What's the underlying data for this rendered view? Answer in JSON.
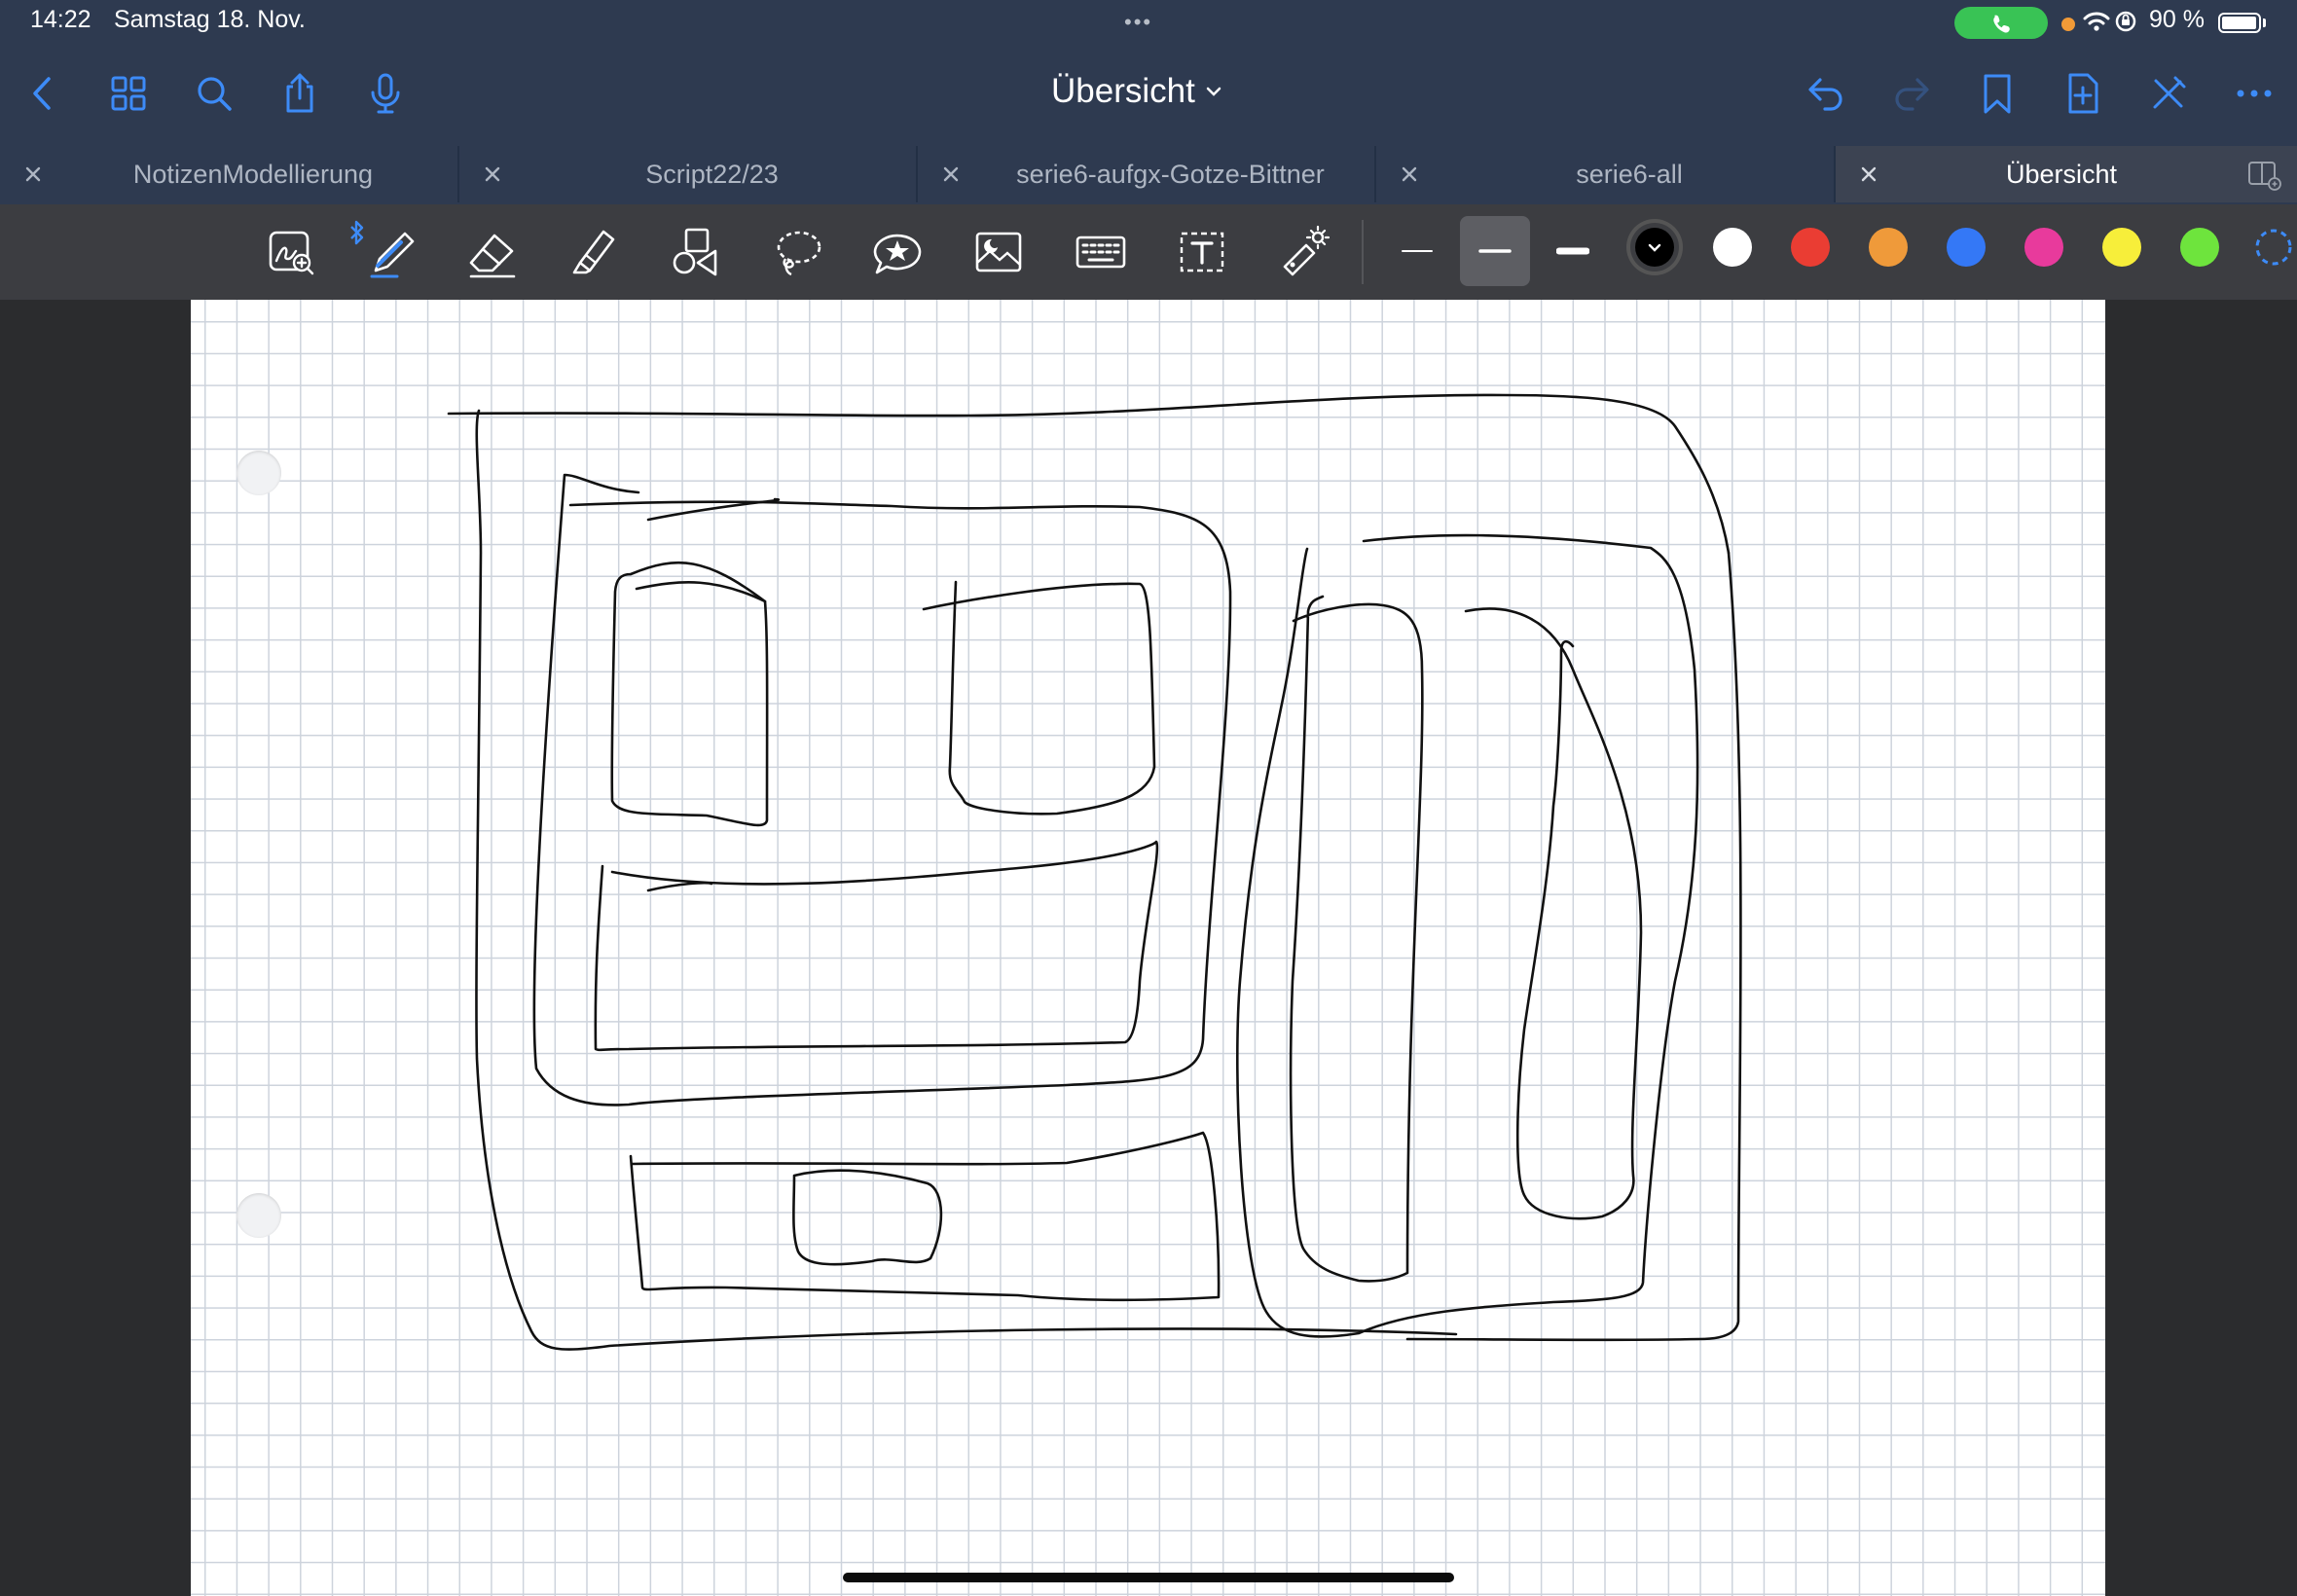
{
  "status_bar": {
    "time": "14:22",
    "date": "Samstag 18. Nov.",
    "battery": "90 %",
    "multitask_indicator": "•••",
    "icons": [
      "phone-call-icon",
      "microphone-indicator",
      "wifi-icon",
      "orientation-lock-icon",
      "battery-icon"
    ]
  },
  "nav": {
    "document_title": "Übersicht",
    "left_buttons": [
      "back-icon",
      "grid-icon",
      "search-icon",
      "share-icon",
      "microphone-icon"
    ],
    "right_buttons": [
      "undo-icon",
      "redo-icon",
      "bookmark-icon",
      "add-page-icon",
      "close-pen-icon",
      "more-icon"
    ],
    "accent_color": "#3d8bf7"
  },
  "tabs": [
    {
      "label": "NotizenModellierung",
      "active": false
    },
    {
      "label": "Script22/23",
      "active": false
    },
    {
      "label": "serie6-aufgx-Gotze-Bittner",
      "active": false
    },
    {
      "label": "serie6-all",
      "active": false
    },
    {
      "label": "Übersicht",
      "active": true
    }
  ],
  "toolbar": {
    "tools": [
      "zoom-window-icon",
      "pen-icon",
      "eraser-icon",
      "highlighter-icon",
      "shapes-icon",
      "lasso-icon",
      "sticker-icon",
      "image-icon",
      "keyboard-icon",
      "text-box-icon",
      "laser-pointer-icon"
    ],
    "selected_tool": "pen-icon",
    "bluetooth_indicator": "bluetooth-icon",
    "stroke_widths": [
      "thin",
      "medium",
      "thick"
    ],
    "selected_stroke": "medium",
    "colors": [
      "#000000",
      "#ffffff",
      "#ea3d33",
      "#ef9a3a",
      "#3478f6",
      "#e83a9c",
      "#f7ee3a",
      "#6ee43d"
    ],
    "selected_color": "#000000"
  },
  "canvas": {
    "paper": "grid",
    "background": "#ffffff",
    "grid_color": "#cdd3dc",
    "ink_color": "#111111"
  }
}
